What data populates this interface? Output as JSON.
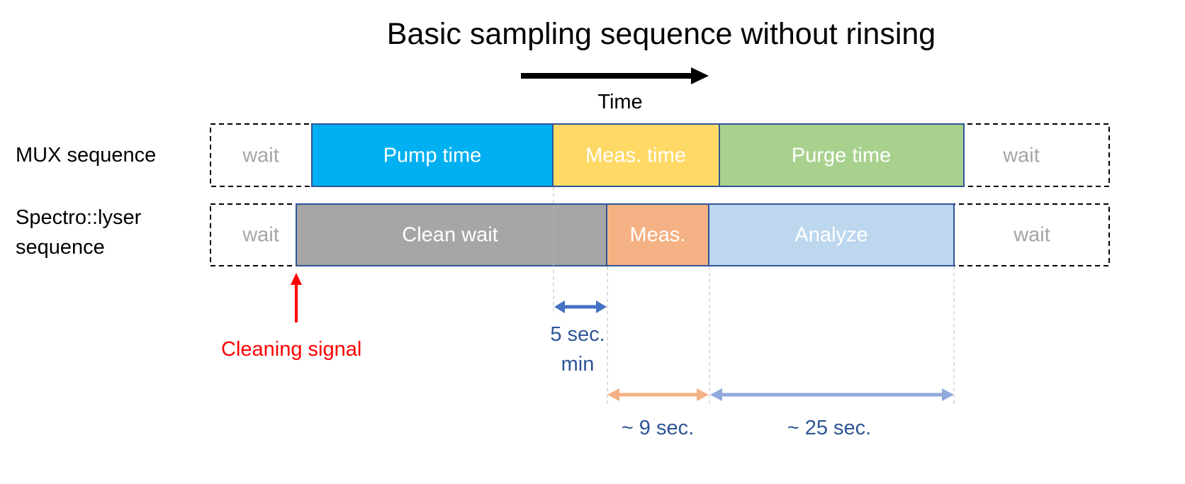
{
  "title": "Basic sampling sequence without rinsing",
  "time_label": "Time",
  "rows": {
    "mux": {
      "label": "MUX sequence",
      "wait_before": "wait",
      "wait_after": "wait",
      "blocks": [
        {
          "label": "Pump time",
          "color": "#00B0F0"
        },
        {
          "label": "Meas. time",
          "color": "#FFD966"
        },
        {
          "label": "Purge time",
          "color": "#A9D18E"
        }
      ]
    },
    "spectro": {
      "label_line1": "Spectro::lyser",
      "label_line2": "sequence",
      "wait_before": "wait",
      "wait_after": "wait",
      "blocks": [
        {
          "label": "Clean wait",
          "color": "#A6A6A6"
        },
        {
          "label": "Meas.",
          "color": "#F4B183"
        },
        {
          "label": "Analyze",
          "color": "#BDD7EE"
        }
      ]
    }
  },
  "cleaning_signal": {
    "label": "Cleaning signal",
    "color": "#FF0000"
  },
  "durations": {
    "offset": {
      "line1": "5 sec.",
      "line2": "min",
      "color": "#4472C4"
    },
    "meas": {
      "label": "~ 9 sec.",
      "color": "#F4B183"
    },
    "analyze": {
      "label": "~ 25 sec.",
      "color": "#8FAADC"
    }
  }
}
